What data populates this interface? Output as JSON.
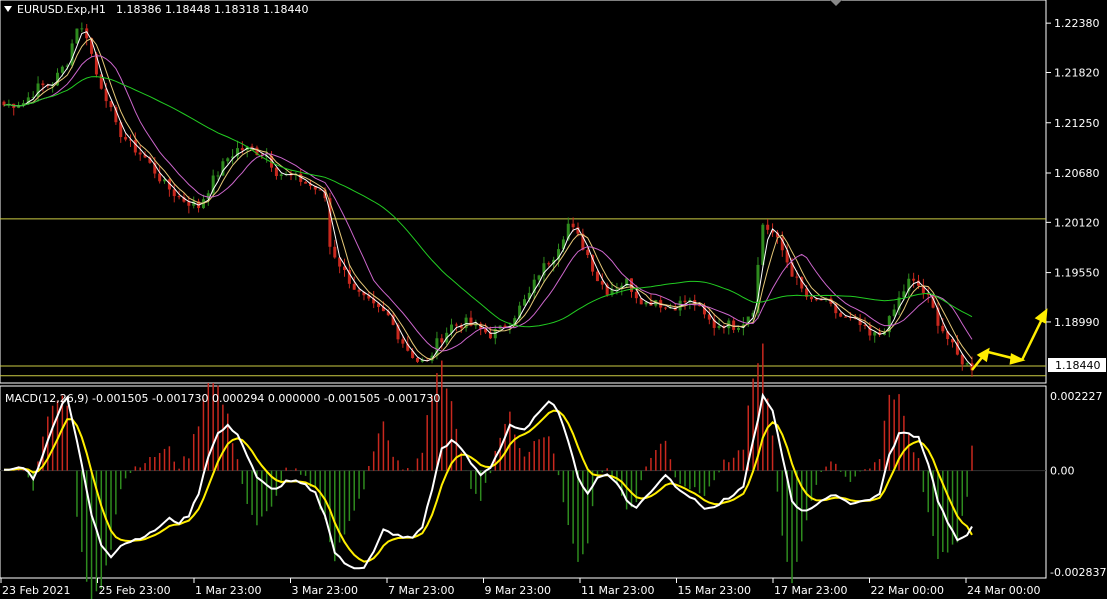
{
  "header": {
    "symbol": "EURUSD.Exp,H1",
    "ohlc": "1.18386 1.18448 1.18318 1.18440"
  },
  "macd": {
    "label": "MACD(12,26,9) -0.001505 -0.001730 0.000294 0.000000 -0.001505 -0.001730",
    "axis_labels": [
      "0.002227",
      "0.00",
      "-0.002837"
    ]
  },
  "price_axis_labels": [
    "1.22380",
    "1.21820",
    "1.21250",
    "1.20680",
    "1.20120",
    "1.19550",
    "1.18990"
  ],
  "current_price": "1.18440",
  "time_labels": [
    "23 Feb 2021",
    "25 Feb 23:00",
    "1 Mar 23:00",
    "3 Mar 23:00",
    "7 Mar 23:00",
    "9 Mar 23:00",
    "11 Mar 23:00",
    "15 Mar 23:00",
    "17 Mar 23:00",
    "22 Mar 00:00",
    "24 Mar 00:00"
  ],
  "colors": {
    "background": "#000000",
    "bull": "#2e8b1e",
    "bear": "#c8281e",
    "ma_fast": "#ffffff",
    "ma_mid": "#e6c878",
    "ma_slow": "#cc66cc",
    "ma_long": "#22cc22",
    "level_line": "#cccc44",
    "macd_line": "#ffffff",
    "signal_line": "#ffee00",
    "arrow": "#ffee00",
    "grid": "#ffffff"
  },
  "chart_data": {
    "type": "candlestick",
    "symbol": "EURUSD.Exp",
    "timeframe": "H1",
    "price_range": [
      1.1832,
      1.2262
    ],
    "horizontal_levels": [
      1.2016,
      1.1849,
      1.1838
    ],
    "price_keypoints": [
      [
        0,
        1.2145
      ],
      [
        4,
        1.2148
      ],
      [
        7,
        1.2165
      ],
      [
        10,
        1.217
      ],
      [
        13,
        1.2195
      ],
      [
        15,
        1.2235
      ],
      [
        17,
        1.2225
      ],
      [
        19,
        1.218
      ],
      [
        21,
        1.2155
      ],
      [
        23,
        1.212
      ],
      [
        26,
        1.21
      ],
      [
        29,
        1.2085
      ],
      [
        31,
        1.207
      ],
      [
        33,
        1.2055
      ],
      [
        36,
        1.204
      ],
      [
        40,
        1.203
      ],
      [
        43,
        1.206
      ],
      [
        46,
        1.2085
      ],
      [
        48,
        1.2095
      ],
      [
        51,
        1.2095
      ],
      [
        54,
        1.2088
      ],
      [
        56,
        1.207
      ],
      [
        58,
        1.2065
      ],
      [
        61,
        1.206
      ],
      [
        64,
        1.205
      ],
      [
        66,
        1.204
      ],
      [
        67,
        1.1985
      ],
      [
        70,
        1.1955
      ],
      [
        73,
        1.193
      ],
      [
        76,
        1.1915
      ],
      [
        79,
        1.1905
      ],
      [
        81,
        1.1885
      ],
      [
        83,
        1.1868
      ],
      [
        85,
        1.1855
      ],
      [
        87,
        1.1852
      ],
      [
        89,
        1.1875
      ],
      [
        92,
        1.1895
      ],
      [
        95,
        1.1898
      ],
      [
        98,
        1.189
      ],
      [
        100,
        1.1885
      ],
      [
        102,
        1.189
      ],
      [
        104,
        1.19
      ],
      [
        106,
        1.1915
      ],
      [
        108,
        1.193
      ],
      [
        110,
        1.1955
      ],
      [
        113,
        1.1975
      ],
      [
        116,
        1.201
      ],
      [
        118,
        1.1995
      ],
      [
        120,
        1.1975
      ],
      [
        122,
        1.1948
      ],
      [
        124,
        1.1935
      ],
      [
        126,
        1.194
      ],
      [
        128,
        1.1945
      ],
      [
        130,
        1.193
      ],
      [
        132,
        1.192
      ],
      [
        134,
        1.1925
      ],
      [
        136,
        1.1915
      ],
      [
        138,
        1.1918
      ],
      [
        140,
        1.1922
      ],
      [
        142,
        1.192
      ],
      [
        144,
        1.1905
      ],
      [
        146,
        1.1895
      ],
      [
        148,
        1.1897
      ],
      [
        150,
        1.1895
      ],
      [
        152,
        1.19
      ],
      [
        154,
        1.1915
      ],
      [
        156,
        1.201
      ],
      [
        158,
        1.2
      ],
      [
        160,
        1.198
      ],
      [
        162,
        1.1955
      ],
      [
        164,
        1.1935
      ],
      [
        166,
        1.192
      ],
      [
        168,
        1.1925
      ],
      [
        170,
        1.1915
      ],
      [
        172,
        1.1905
      ],
      [
        174,
        1.19
      ],
      [
        176,
        1.1895
      ],
      [
        178,
        1.1882
      ],
      [
        180,
        1.1885
      ],
      [
        182,
        1.19
      ],
      [
        184,
        1.1925
      ],
      [
        186,
        1.1945
      ],
      [
        188,
        1.194
      ],
      [
        190,
        1.1925
      ],
      [
        192,
        1.19
      ],
      [
        194,
        1.188
      ],
      [
        196,
        1.186
      ],
      [
        198,
        1.185
      ],
      [
        199,
        1.1844
      ]
    ],
    "macd_range": [
      -0.002837,
      0.002227
    ],
    "macd_last": -0.001505,
    "signal_last": -0.00173,
    "macd_keypoints": [
      [
        0,
        0.0
      ],
      [
        4,
        0.0001
      ],
      [
        6,
        -0.0002
      ],
      [
        8,
        0.0004
      ],
      [
        10,
        0.0012
      ],
      [
        12,
        0.0018
      ],
      [
        13,
        0.002
      ],
      [
        15,
        0.0008
      ],
      [
        18,
        -0.0012
      ],
      [
        20,
        -0.002
      ],
      [
        22,
        -0.0023
      ],
      [
        24,
        -0.002
      ],
      [
        26,
        -0.0019
      ],
      [
        28,
        -0.0018
      ],
      [
        30,
        -0.0017
      ],
      [
        32,
        -0.0015
      ],
      [
        34,
        -0.0013
      ],
      [
        36,
        -0.0014
      ],
      [
        38,
        -0.0012
      ],
      [
        40,
        -0.0006
      ],
      [
        42,
        0.0004
      ],
      [
        44,
        0.001
      ],
      [
        46,
        0.0012
      ],
      [
        48,
        0.001
      ],
      [
        50,
        0.0004
      ],
      [
        52,
        -0.0002
      ],
      [
        54,
        -0.0004
      ],
      [
        56,
        -0.0005
      ],
      [
        58,
        -0.0003
      ],
      [
        60,
        -0.0003
      ],
      [
        62,
        -0.0004
      ],
      [
        64,
        -0.0006
      ],
      [
        66,
        -0.0012
      ],
      [
        68,
        -0.0022
      ],
      [
        70,
        -0.0025
      ],
      [
        72,
        -0.0026
      ],
      [
        74,
        -0.0026
      ],
      [
        76,
        -0.0022
      ],
      [
        78,
        -0.0016
      ],
      [
        80,
        -0.0017
      ],
      [
        82,
        -0.0018
      ],
      [
        84,
        -0.0018
      ],
      [
        86,
        -0.0015
      ],
      [
        88,
        -0.0005
      ],
      [
        90,
        0.0006
      ],
      [
        92,
        0.0008
      ],
      [
        94,
        0.0006
      ],
      [
        96,
        0.0002
      ],
      [
        98,
        -0.0001
      ],
      [
        100,
        0.0001
      ],
      [
        102,
        0.0006
      ],
      [
        104,
        0.0012
      ],
      [
        106,
        0.0011
      ],
      [
        108,
        0.0012
      ],
      [
        110,
        0.0016
      ],
      [
        112,
        0.0019
      ],
      [
        114,
        0.0016
      ],
      [
        116,
        0.0008
      ],
      [
        118,
        -0.0002
      ],
      [
        120,
        -0.0006
      ],
      [
        122,
        -0.0002
      ],
      [
        124,
        -0.0001
      ],
      [
        126,
        -0.0003
      ],
      [
        128,
        -0.0008
      ],
      [
        130,
        -0.001
      ],
      [
        132,
        -0.0007
      ],
      [
        134,
        -0.0004
      ],
      [
        136,
        -0.0001
      ],
      [
        138,
        -0.0004
      ],
      [
        140,
        -0.0006
      ],
      [
        142,
        -0.0008
      ],
      [
        144,
        -0.001
      ],
      [
        146,
        -0.001
      ],
      [
        148,
        -0.0008
      ],
      [
        150,
        -0.0007
      ],
      [
        152,
        -0.0004
      ],
      [
        154,
        0.0008
      ],
      [
        156,
        0.002
      ],
      [
        158,
        0.0016
      ],
      [
        160,
        0.0004
      ],
      [
        162,
        -0.0008
      ],
      [
        164,
        -0.0011
      ],
      [
        166,
        -0.001
      ],
      [
        168,
        -0.0008
      ],
      [
        170,
        -0.0007
      ],
      [
        172,
        -0.0007
      ],
      [
        174,
        -0.0009
      ],
      [
        176,
        -0.0008
      ],
      [
        178,
        -0.0008
      ],
      [
        180,
        -0.0006
      ],
      [
        182,
        0.0004
      ],
      [
        184,
        0.001
      ],
      [
        186,
        0.001
      ],
      [
        188,
        0.0009
      ],
      [
        190,
        0.0002
      ],
      [
        192,
        -0.0008
      ],
      [
        194,
        -0.0014
      ],
      [
        196,
        -0.0019
      ],
      [
        198,
        -0.0017
      ],
      [
        199,
        -0.0015
      ]
    ]
  }
}
